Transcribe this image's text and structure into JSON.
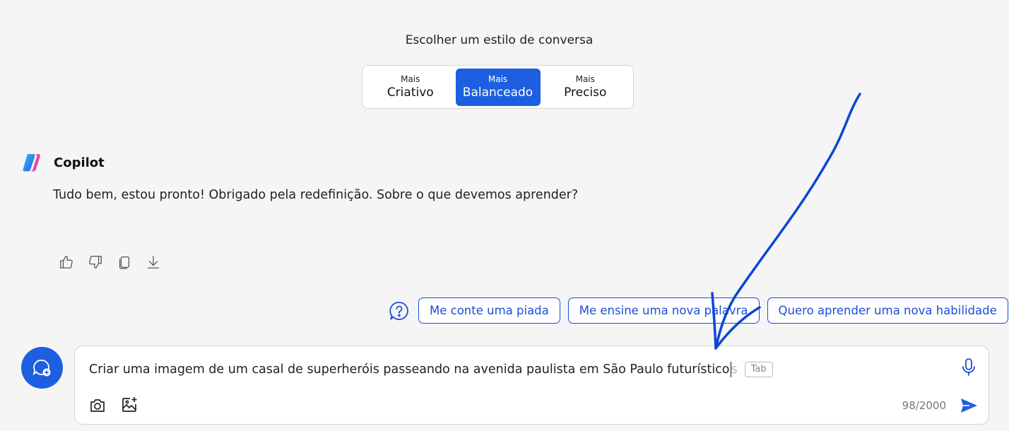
{
  "style_picker": {
    "title": "Escolher um estilo de conversa",
    "options": [
      {
        "small": "Mais",
        "big": "Criativo"
      },
      {
        "small": "Mais",
        "big": "Balanceado",
        "active": true
      },
      {
        "small": "Mais",
        "big": "Preciso"
      }
    ]
  },
  "assistant": {
    "name": "Copilot",
    "message": "Tudo bem, estou pronto! Obrigado pela redefinição. Sobre o que devemos aprender?"
  },
  "suggestions": [
    "Me conte uma piada",
    "Me ensine uma nova palavra",
    "Quero aprender uma nova habilidade"
  ],
  "composer": {
    "text": "Criar uma imagem de um casal de superheróis passeando na avenida paulista em São Paulo futurístico",
    "ghost_text": "s",
    "tab_hint": "Tab",
    "counter": "98/2000"
  },
  "colors": {
    "accent": "#1d5fe0",
    "chip_border": "#1d4ed8",
    "annotation_stroke": "#0b45d6"
  }
}
